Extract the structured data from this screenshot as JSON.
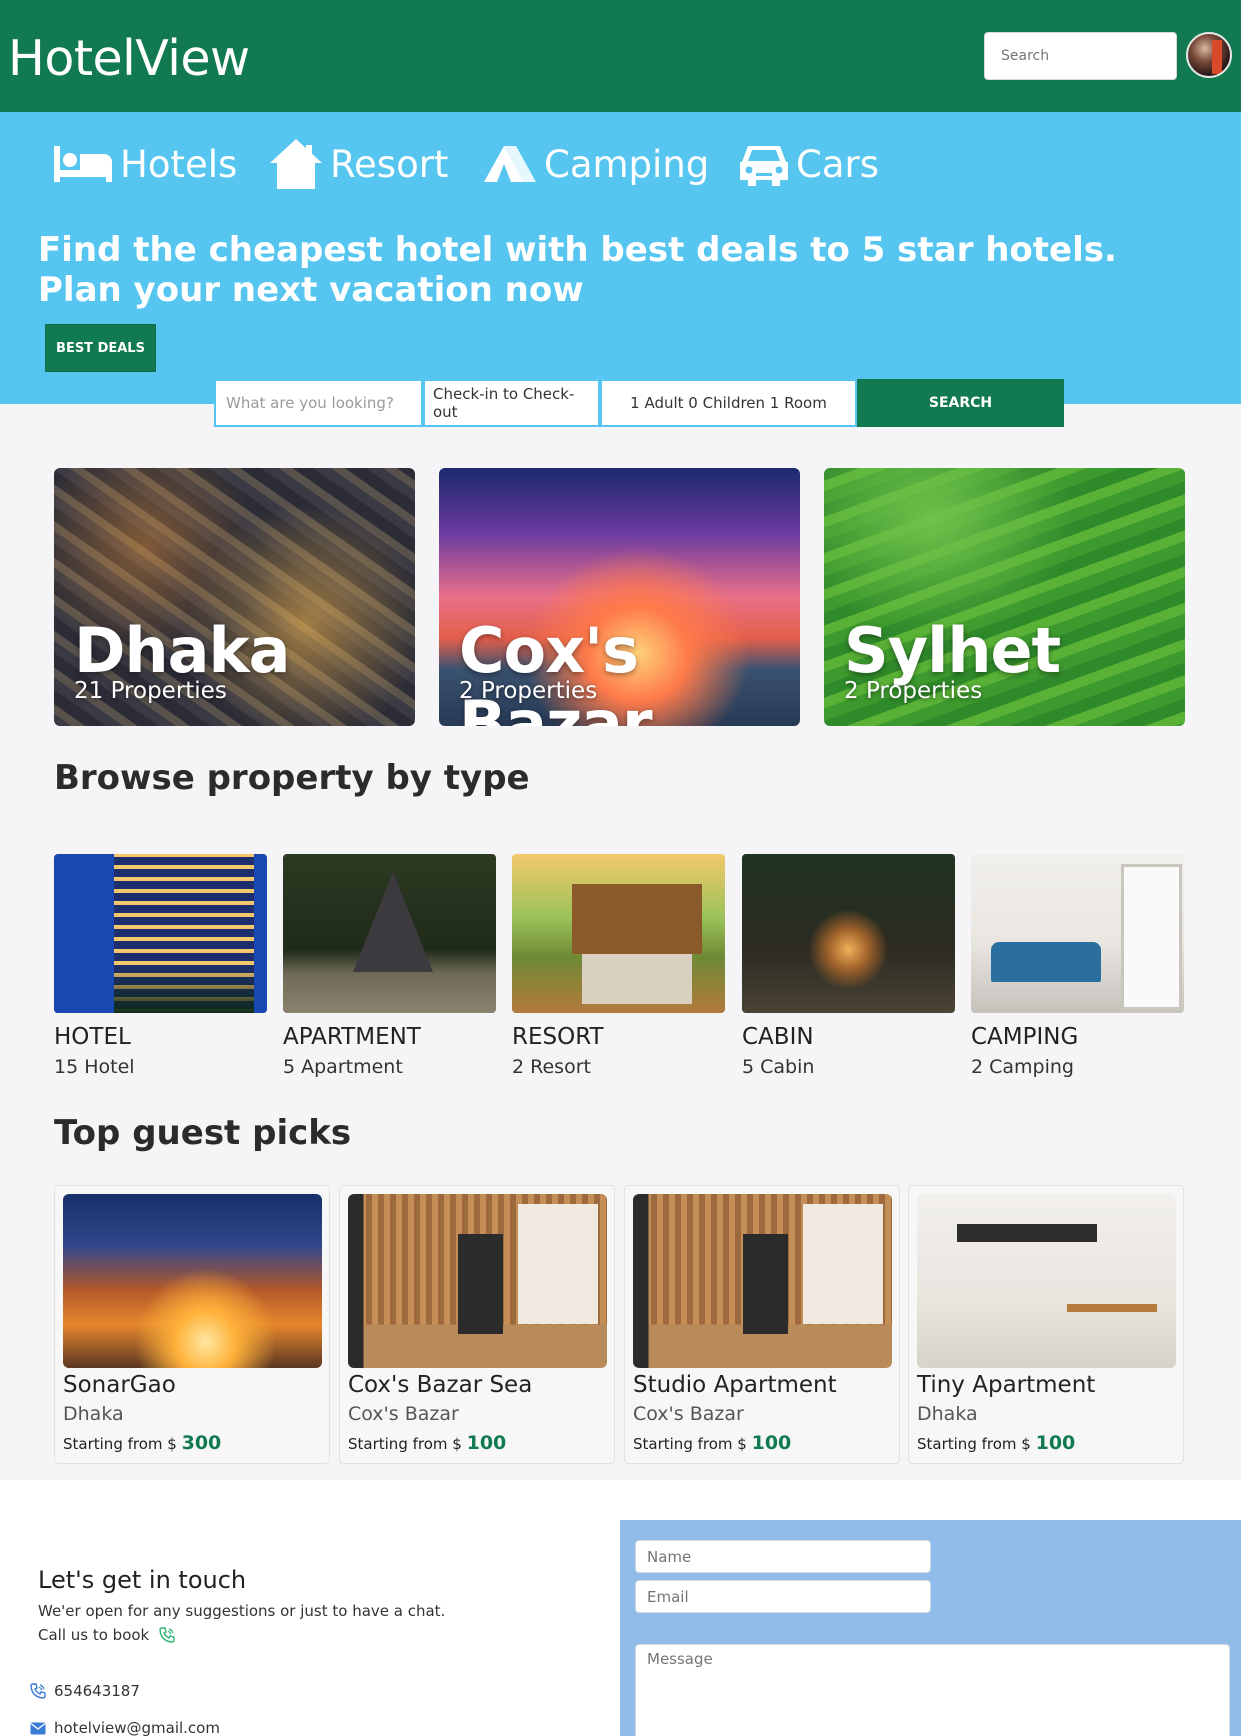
{
  "header": {
    "brand": "HotelView",
    "search_placeholder": "Search"
  },
  "categories": [
    {
      "label": "Hotels",
      "icon": "bed-icon"
    },
    {
      "label": "Resort",
      "icon": "house-icon"
    },
    {
      "label": "Camping",
      "icon": "tent-icon"
    },
    {
      "label": "Cars",
      "icon": "car-icon"
    }
  ],
  "hero": {
    "title_line1": "Find the cheapest hotel with best deals to 5 star hotels.",
    "title_line2": "Plan your next vacation now",
    "cta": "BEST DEALS"
  },
  "search": {
    "what_placeholder": "What are you looking?",
    "dates": "Check-in to Check-out",
    "guests": "1 Adult 0 Children 1 Room",
    "button": "SEARCH"
  },
  "cities": [
    {
      "name": "Dhaka",
      "properties": "21 Properties"
    },
    {
      "name": "Cox's Bazar",
      "properties": "2 Properties"
    },
    {
      "name": "Sylhet",
      "properties": "2 Properties"
    }
  ],
  "browse": {
    "heading": "Browse property by type",
    "types": [
      {
        "name": "HOTEL",
        "count": "15 Hotel"
      },
      {
        "name": "APARTMENT",
        "count": "5 Apartment"
      },
      {
        "name": "RESORT",
        "count": "2 Resort"
      },
      {
        "name": "CABIN",
        "count": "5 Cabin"
      },
      {
        "name": "CAMPING",
        "count": "2 Camping"
      }
    ]
  },
  "picks": {
    "heading": "Top guest picks",
    "items": [
      {
        "name": "SonarGao",
        "location": "Dhaka",
        "price_prefix": "Starting from $",
        "price": "300"
      },
      {
        "name": "Cox's Bazar Sea",
        "location": "Cox's Bazar",
        "price_prefix": "Starting from $",
        "price": "100"
      },
      {
        "name": "Studio Apartment",
        "location": "Cox's Bazar",
        "price_prefix": "Starting from $",
        "price": "100"
      },
      {
        "name": "Tiny Apartment",
        "location": "Dhaka",
        "price_prefix": "Starting from $",
        "price": "100"
      }
    ]
  },
  "footer": {
    "title": "Let's get in touch",
    "subtitle": "We'er open for any suggestions or just to have a chat.",
    "call_text": "Call us to book",
    "phone": "654643187",
    "email": "hotelview@gmail.com",
    "name_placeholder": "Name",
    "email_placeholder": "Email",
    "message_placeholder": "Message"
  },
  "colors": {
    "brand_green": "#127a50",
    "hero_blue": "#56c6f0",
    "form_blue": "#8fbce8"
  }
}
